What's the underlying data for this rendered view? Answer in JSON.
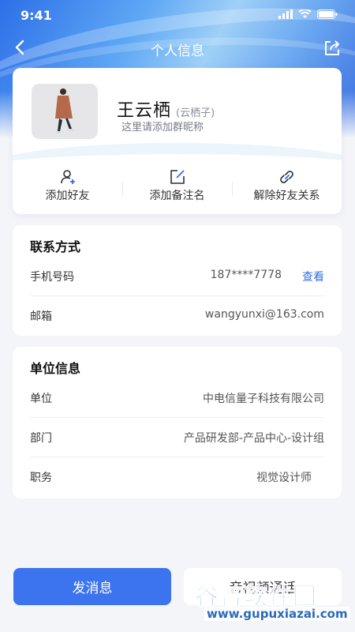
{
  "status_bar": {
    "time": "9:41"
  },
  "nav": {
    "title": "个人信息"
  },
  "profile": {
    "name": "王云栖",
    "alias": "(云栖子)",
    "nickname_placeholder": "这里请添加群昵称"
  },
  "actions": [
    {
      "label": "添加好友",
      "icon": "add-user-icon"
    },
    {
      "label": "添加备注名",
      "icon": "edit-note-icon"
    },
    {
      "label": "解除好友关系",
      "icon": "unlink-icon"
    }
  ],
  "contact": {
    "title": "联系方式",
    "phone_label": "手机号码",
    "phone_value": "187****7778",
    "phone_view": "查看",
    "email_label": "邮箱",
    "email_value": "wangyunxi@163.com"
  },
  "org": {
    "title": "单位信息",
    "company_label": "单位",
    "company_value": "中电信量子科技有限公司",
    "dept_label": "部门",
    "dept_value": "产品研发部-产品中心-设计组",
    "position_label": "职务",
    "position_value": "视觉设计师"
  },
  "buttons": {
    "send_message": "发消息",
    "av_call": "音视频通话"
  },
  "watermark": {
    "brand": "谷普软件园",
    "url": "www.gupuxiazai.com"
  },
  "colors": {
    "accent": "#3b74ee",
    "link": "#2f6fe6",
    "background": "#f3f5f9"
  }
}
